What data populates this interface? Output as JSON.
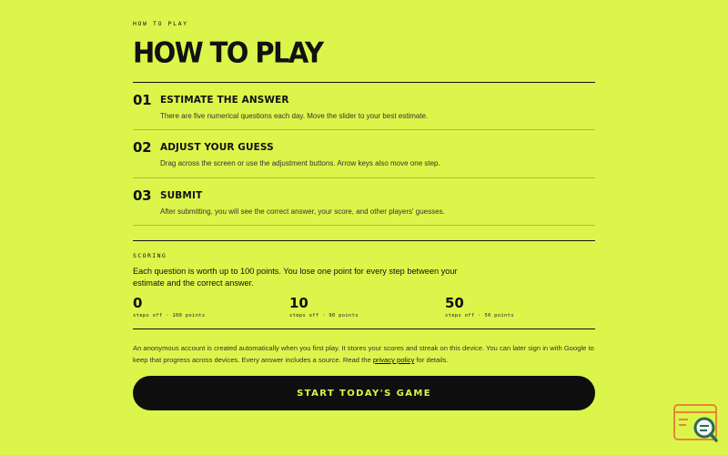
{
  "eyebrow": "HOW TO PLAY",
  "title": "HOW TO PLAY",
  "steps": [
    {
      "number": "01",
      "title": "ESTIMATE THE ANSWER",
      "description": "There are five numerical questions each day. Move the slider to your best estimate."
    },
    {
      "number": "02",
      "title": "ADJUST YOUR GUESS",
      "description": "Drag across the screen or use the adjustment buttons. Arrow keys also move one step."
    },
    {
      "number": "03",
      "title": "SUBMIT",
      "description": "After submitting, you will see the correct answer, your score, and other players' guesses."
    }
  ],
  "scoring": {
    "label": "SCORING",
    "text": "Each question is worth up to 100 points. You lose one point for every step between your estimate and the correct answer.",
    "stats": [
      {
        "value": "0",
        "label": "steps off · 100 points"
      },
      {
        "value": "10",
        "label": "steps off · 90 points"
      },
      {
        "value": "50",
        "label": "steps off · 50 points"
      }
    ]
  },
  "footer": {
    "text_before": "An anonymous account is created automatically when you first play. It stores your scores and streak on this device. You can later sign in with Google to keep that progress across devices. Every answer includes a source. Read the ",
    "link_label": "privacy policy",
    "text_after": " for details."
  },
  "cta_label": "START TODAY'S GAME",
  "colors": {
    "background": "#dcf54a",
    "text": "#111111",
    "button": "#0f0f0f",
    "watermark_accent": "#e8853a",
    "watermark_dark": "#2a6b55"
  }
}
